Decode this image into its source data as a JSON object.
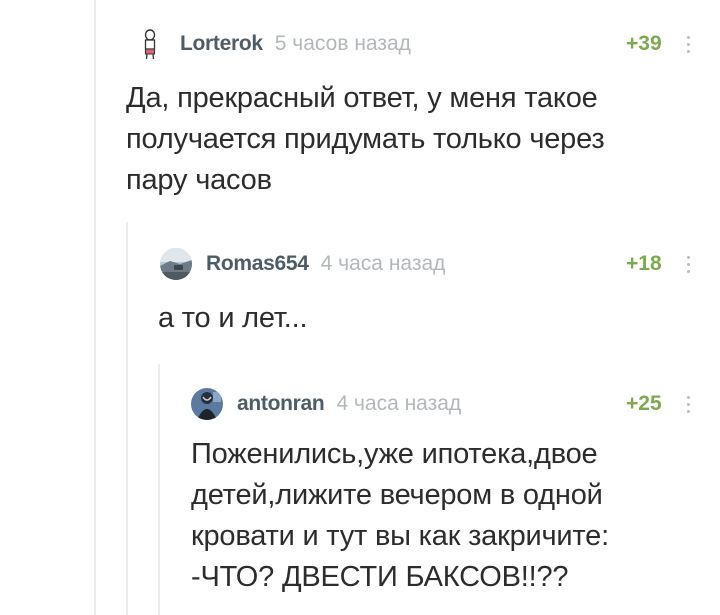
{
  "comments": [
    {
      "username": "Lorterok",
      "time": "5 часов назад",
      "rating": "+39",
      "text": "Да, прекрасный ответ, у меня такое\nполучается придумать только через\nпару часов",
      "avatar_icon": "stick-figure-avatar"
    },
    {
      "username": "Romas654",
      "time": "4 часа назад",
      "rating": "+18",
      "text": "а то и лет...",
      "avatar_icon": "landscape-photo-avatar"
    },
    {
      "username": "antonran",
      "time": "4 часа назад",
      "rating": "+25",
      "text": "Поженились,уже ипотека,двое\nдетей,лижите вечером в одной\nкровати и тут вы как закричите:\n-ЧТО? ДВЕСТИ БАКСОВ!!??",
      "avatar_icon": "dark-photo-avatar"
    }
  ],
  "colors": {
    "username": "#4e5c66",
    "time": "#b2b7ba",
    "rating": "#7bab4e",
    "text": "#2c2c2c",
    "thread_line": "#ececec"
  }
}
